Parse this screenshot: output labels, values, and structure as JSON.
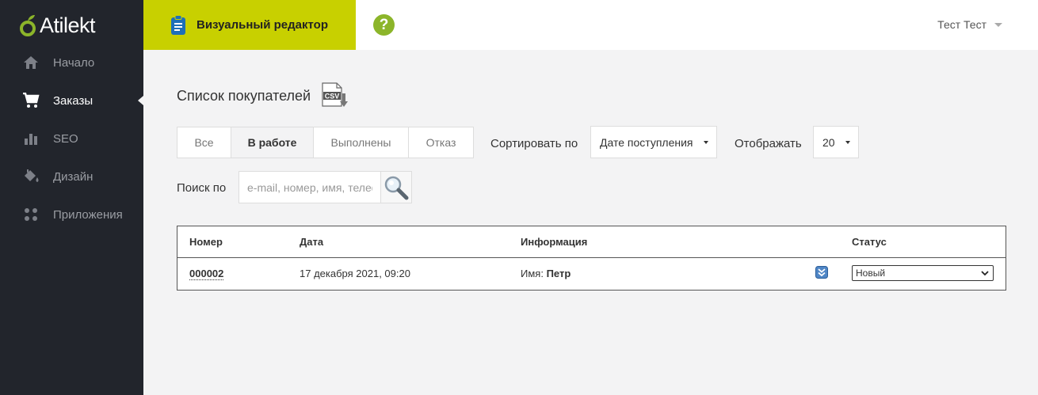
{
  "brand": {
    "name": "Atilekt"
  },
  "sidebar": {
    "items": [
      {
        "label": "Начало",
        "icon": "home-icon"
      },
      {
        "label": "Заказы",
        "icon": "cart-icon",
        "active": true
      },
      {
        "label": "SEO",
        "icon": "bar-chart-icon"
      },
      {
        "label": "Дизайн",
        "icon": "paint-bucket-icon"
      },
      {
        "label": "Приложения",
        "icon": "apps-grid-icon"
      }
    ]
  },
  "topbar": {
    "visual_editor_label": "Визуальный редактор",
    "help_label": "?",
    "user_name": "Тест Тест"
  },
  "page": {
    "title": "Список покупателей",
    "csv_icon_label": "CSV"
  },
  "filters": {
    "tabs": [
      {
        "label": "Все"
      },
      {
        "label": "В работе",
        "active": true
      },
      {
        "label": "Выполнены"
      },
      {
        "label": "Отказ"
      }
    ],
    "sort_label": "Сортировать по",
    "sort_value": "Дате поступления",
    "show_label": "Отображать",
    "show_value": "20"
  },
  "search": {
    "label": "Поиск по",
    "placeholder": "e-mail, номер, имя, телефон"
  },
  "table": {
    "headers": {
      "number": "Номер",
      "date": "Дата",
      "info": "Информация",
      "status": "Статус"
    },
    "rows": [
      {
        "number": "000002",
        "date": "17 декабря 2021, 09:20",
        "info_label": "Имя:",
        "info_value": "Петр",
        "status": "Новый"
      }
    ]
  },
  "colors": {
    "sidebar_bg": "#22252c",
    "accent": "#c8d000",
    "help_green": "#8cb52a",
    "page_bg": "#f3f3f4"
  }
}
